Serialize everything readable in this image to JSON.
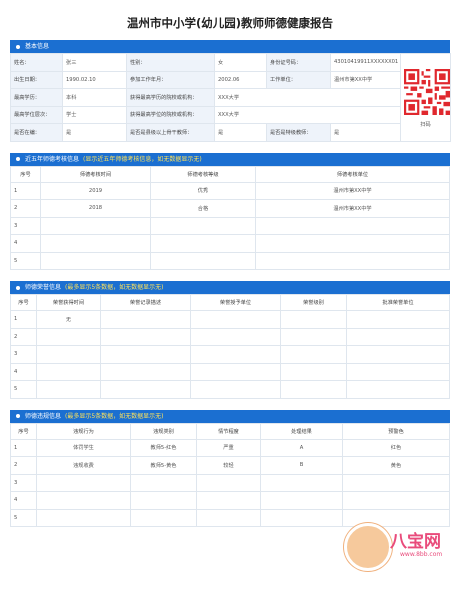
{
  "title": "温州市中小学(幼儿园)教师师德健康报告",
  "basic": {
    "heading": "基本信息",
    "rows": [
      [
        [
          "姓名：",
          "张三"
        ],
        [
          "性别：",
          "女"
        ],
        [
          "身份证号码：",
          "43010419911XXXXXX01"
        ]
      ],
      [
        [
          "出生日期：",
          "1990.02.10"
        ],
        [
          "参加工作年月：",
          "2002.06"
        ],
        [
          "工作单位：",
          "温州市第XX中学"
        ]
      ],
      [
        [
          "最高学历：",
          "本科"
        ],
        [
          "获得最高学历的院校或机构：",
          "XXX大学"
        ]
      ],
      [
        [
          "最高学位层次：",
          "学士"
        ],
        [
          "获得最高学位的院校或机构：",
          "XXX大学"
        ]
      ],
      [
        [
          "是否在编：",
          "是"
        ],
        [
          "是否是县级以上骨干教师：",
          "是"
        ],
        [
          "是否是特级教师：",
          "是"
        ]
      ]
    ],
    "qr_caption": "扫码"
  },
  "assess": {
    "heading": "近五年师德考核信息",
    "note": "(显示近五年师德考核信息，如无数据显示无)",
    "headers": [
      "序号",
      "师德考核时间",
      "师德考核等级",
      "师德考核单位"
    ],
    "rows": [
      [
        "1",
        "2019",
        "优秀",
        "温州市第XX中学"
      ],
      [
        "2",
        "2018",
        "合格",
        "温州市第XX中学"
      ],
      [
        "3",
        "",
        "",
        ""
      ],
      [
        "4",
        "",
        "",
        ""
      ],
      [
        "5",
        "",
        "",
        ""
      ]
    ]
  },
  "honor": {
    "heading": "师德荣誉信息",
    "note": "(最多显示5条数据，如无数据显示无)",
    "headers": [
      "序号",
      "荣誉获得时间",
      "荣誉记录描述",
      "荣誉授予单位",
      "荣誉级别",
      "批准荣誉单位"
    ],
    "rows": [
      [
        "1",
        "无",
        "",
        "",
        "",
        ""
      ],
      [
        "2",
        "",
        "",
        "",
        "",
        ""
      ],
      [
        "3",
        "",
        "",
        "",
        "",
        ""
      ],
      [
        "4",
        "",
        "",
        "",
        "",
        ""
      ],
      [
        "5",
        "",
        "",
        "",
        "",
        ""
      ]
    ]
  },
  "violation": {
    "heading": "师德违规信息",
    "note": "(最多显示5条数据，如无数据显示无)",
    "headers": [
      "序号",
      "违规行为",
      "违规类别",
      "情节程度",
      "处理结果",
      "预警色"
    ],
    "rows": [
      [
        "1",
        "体罚学生",
        "教师5-红色",
        "严重",
        "A",
        "红色"
      ],
      [
        "2",
        "违规收费",
        "教师5-黄色",
        "较轻",
        "B",
        "黄色"
      ],
      [
        "3",
        "",
        "",
        "",
        "",
        ""
      ],
      [
        "4",
        "",
        "",
        "",
        "",
        ""
      ],
      [
        "5",
        "",
        "",
        "",
        "",
        ""
      ]
    ]
  },
  "watermark": {
    "text": "八宝网",
    "url": "www.8bb.com"
  },
  "colors": {
    "accent": "#1b6fd1",
    "note": "#ffe259",
    "label_bg": "#eef3fa"
  }
}
